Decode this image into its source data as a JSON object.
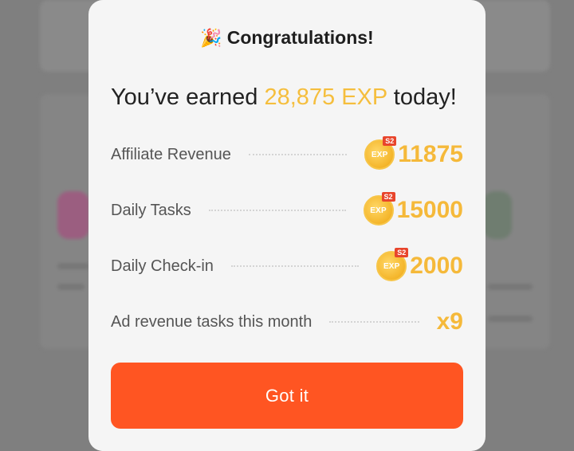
{
  "modal": {
    "title": "Congratulations!",
    "title_icon": "party-popper-icon",
    "headline_prefix": "You’ve earned",
    "headline_amount": "28,875 EXP",
    "headline_suffix": "today!",
    "rows": [
      {
        "label": "Affiliate Revenue",
        "value": "11875",
        "icon": "exp-coin-icon",
        "badge": "S2",
        "coin_text": "EXP"
      },
      {
        "label": "Daily Tasks",
        "value": "15000",
        "icon": "exp-coin-icon",
        "badge": "S2",
        "coin_text": "EXP"
      },
      {
        "label": "Daily Check-in",
        "value": "2000",
        "icon": "exp-coin-icon",
        "badge": "S2",
        "coin_text": "EXP"
      },
      {
        "label": "Ad revenue tasks this month",
        "value": "x9"
      }
    ],
    "button_label": "Got it"
  },
  "colors": {
    "accent_amount": "#f5be3d",
    "button": "#ff5522",
    "badge": "#e8452c"
  }
}
